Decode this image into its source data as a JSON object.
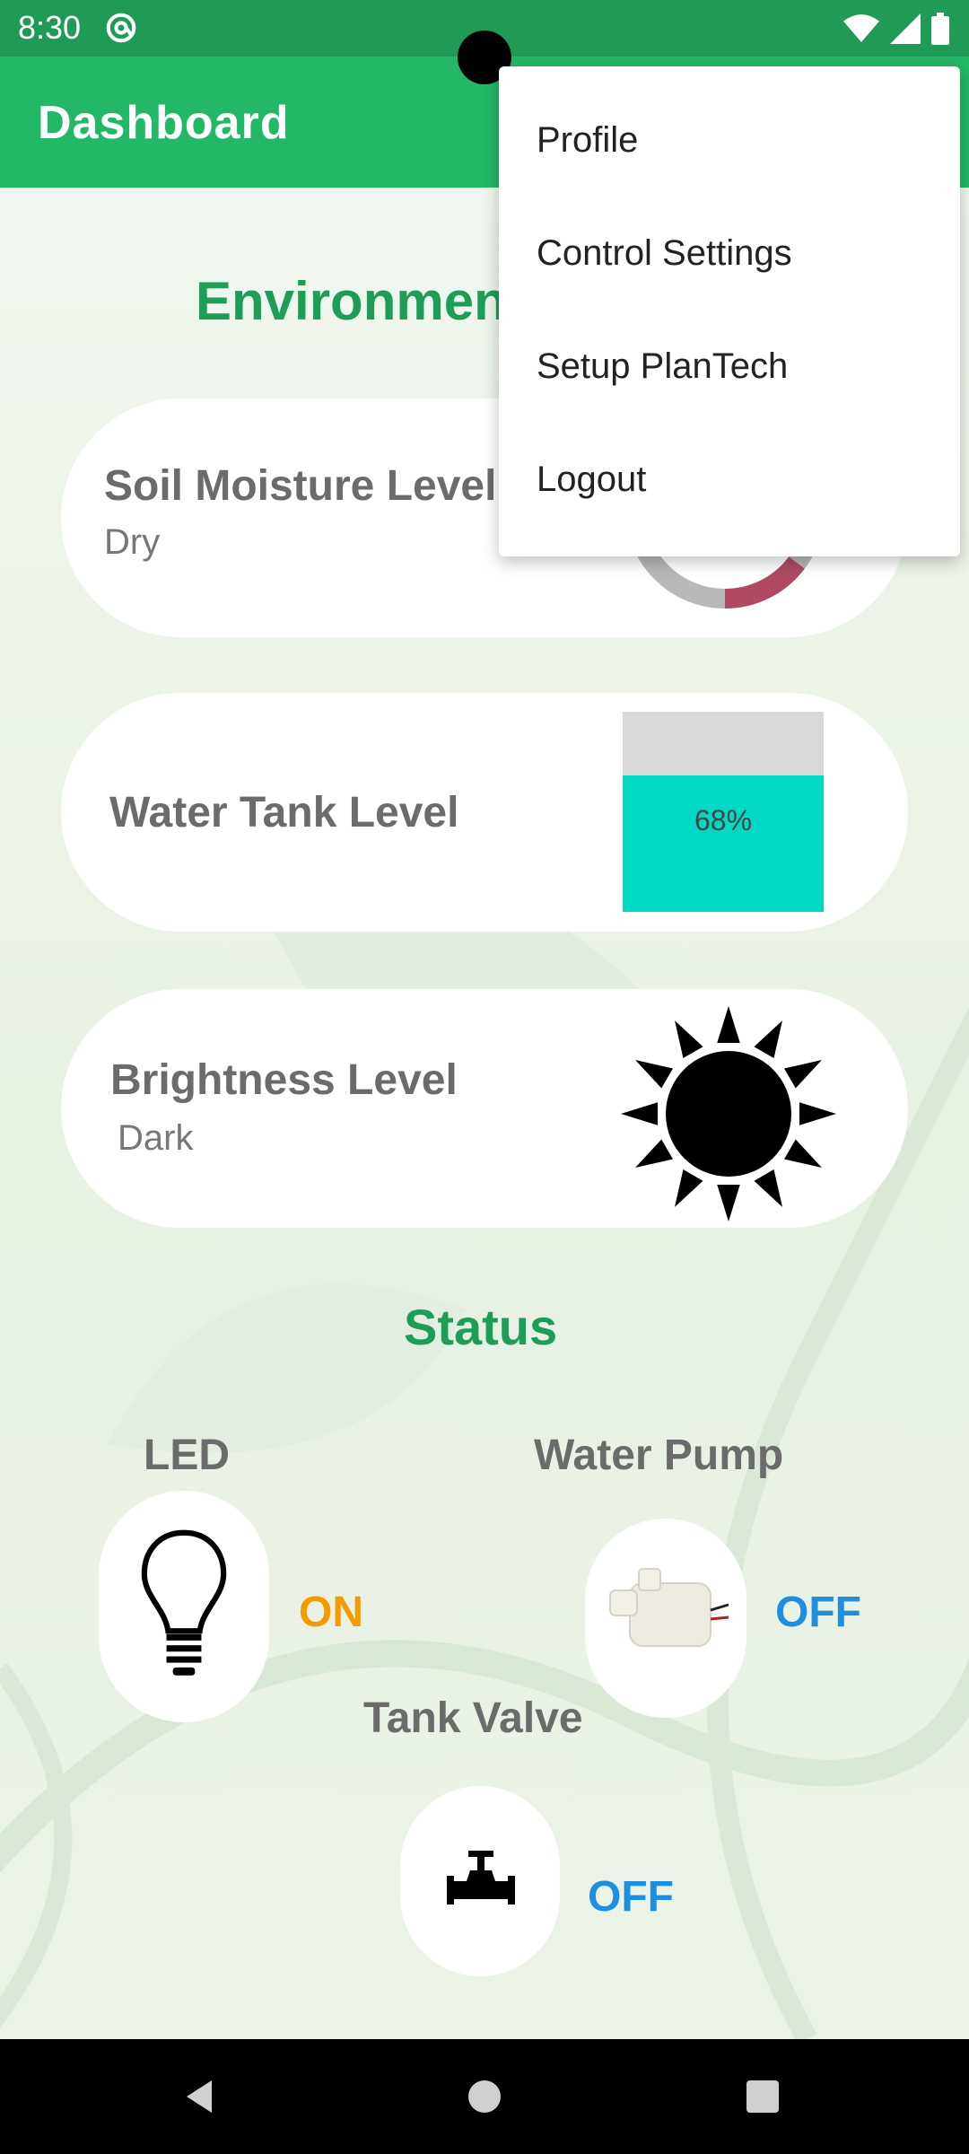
{
  "status_bar": {
    "time": "8:30"
  },
  "app_bar": {
    "title": "Dashboard"
  },
  "environment": {
    "title": "Environment",
    "soil": {
      "label": "Soil Moisture Level",
      "value": "Dry"
    },
    "tank": {
      "label": "Water Tank Level",
      "percent_text": "68%",
      "level": 0.68
    },
    "brightness": {
      "label": "Brightness Level",
      "value": "Dark"
    }
  },
  "status": {
    "title": "Status",
    "led": {
      "label": "LED",
      "state": "ON",
      "state_color": "#f59b00"
    },
    "pump": {
      "label": "Water Pump",
      "state": "OFF",
      "state_color": "#1e8fe0"
    },
    "valve": {
      "label": "Tank Valve",
      "state": "OFF",
      "state_color": "#1e8fe0"
    }
  },
  "menu": {
    "items": [
      "Profile",
      "Control Settings",
      "Setup PlanTech",
      "Logout"
    ]
  },
  "icons": {
    "status_at": "at-sign-icon",
    "wifi": "wifi-icon",
    "signal": "signal-icon",
    "battery": "battery-icon",
    "gauge": "gauge-icon",
    "sun": "sun-icon",
    "bulb": "light-bulb-icon",
    "pump": "water-pump-icon",
    "valve": "valve-icon",
    "back": "back-icon",
    "home": "home-icon",
    "recents": "recents-icon"
  },
  "colors": {
    "status_bar": "#1f9b55",
    "app_bar": "#23b865",
    "accent_green": "#1d9d55",
    "tank_fill": "#00d9c4",
    "gauge_red": "#b04a64"
  }
}
